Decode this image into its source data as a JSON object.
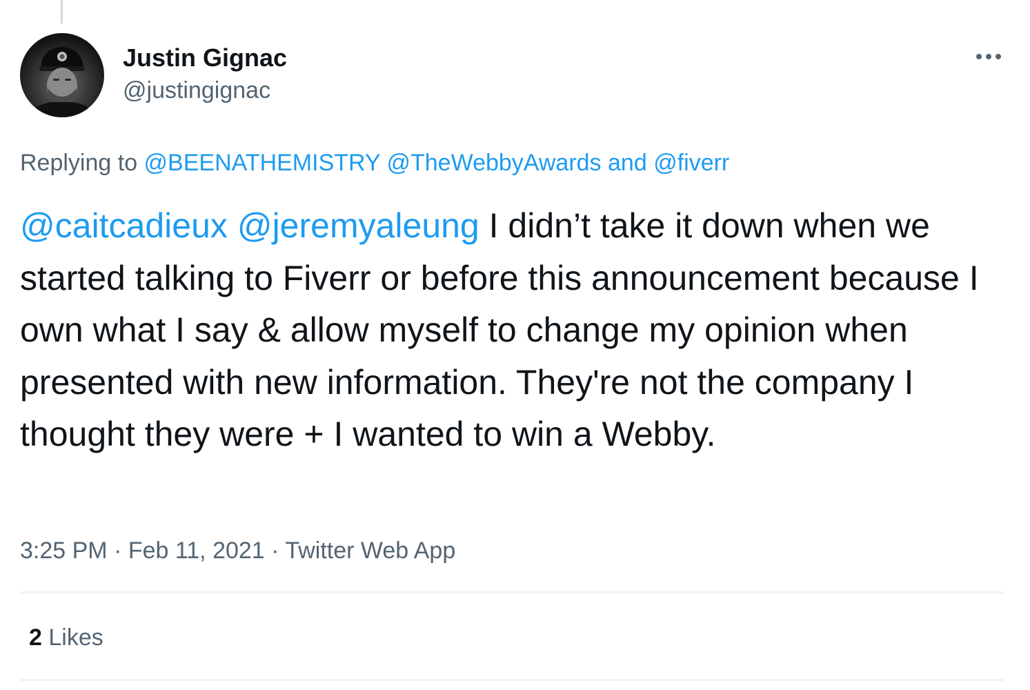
{
  "author": {
    "name": "Justin Gignac",
    "handle": "@justingignac"
  },
  "replying": {
    "prefix": "Replying to ",
    "mention1": "@BEENATHEMISTRY",
    "mention2": "@TheWebbyAwards",
    "conjunction": " and ",
    "mention3": "@fiverr"
  },
  "tweet": {
    "mention1": "@caitcadieux",
    "mention2": "@jeremyaleung",
    "text": " I didn’t take it down when we started talking to Fiverr or before this announcement because I own what I say & allow myself to change my opinion when presented with new information. They're not the company I thought they were + I wanted to win a Webby."
  },
  "meta": {
    "time": "3:25 PM",
    "separator": " · ",
    "date": "Feb 11, 2021",
    "source": "Twitter Web App"
  },
  "engagement": {
    "likes_count": "2",
    "likes_label": "Likes"
  },
  "colors": {
    "link": "#1d9bf0",
    "secondary_text": "#536471",
    "primary_text": "#0f1419",
    "divider": "#eff3f4"
  },
  "icons": {
    "more": "more-horizontal-icon"
  }
}
